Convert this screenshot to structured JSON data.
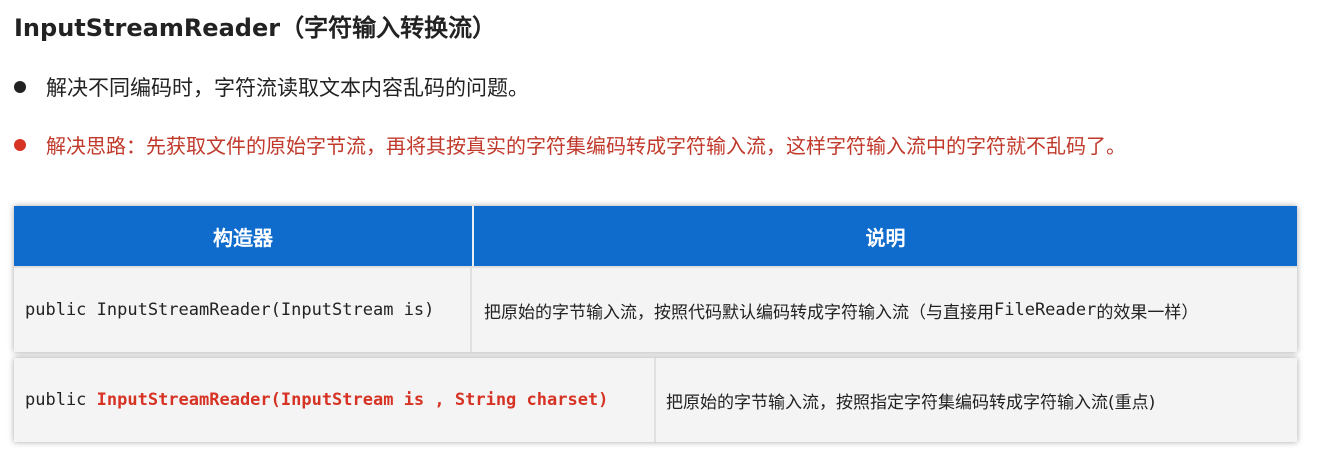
{
  "title": "InputStreamReader（字符输入转换流）",
  "bullets": [
    {
      "text": "解决不同编码时，字符流读取文本内容乱码的问题。",
      "color": "#222222"
    },
    {
      "text": "解决思路：先获取文件的原始字节流，再将其按真实的字符集编码转成字符输入流，这样字符输入流中的字符就不乱码了。",
      "color": "#c0392b"
    }
  ],
  "table": {
    "header": {
      "constructor": "构造器",
      "description": "说明",
      "bg": "#0f6ccd"
    },
    "rows": [
      {
        "constructor": "public InputStreamReader(InputStream is)",
        "description_prefix": "把原始的字节输入流，按照代码默认编码转成字符输入流（与直接用",
        "description_code": "FileReader",
        "description_suffix": "的效果一样）"
      },
      {
        "constructor_prefix": "public ",
        "constructor_highlight": "InputStreamReader(InputStream is , String charset)",
        "description": "把原始的字节输入流，按照指定字符集编码转成字符输入流(重点)"
      }
    ]
  }
}
